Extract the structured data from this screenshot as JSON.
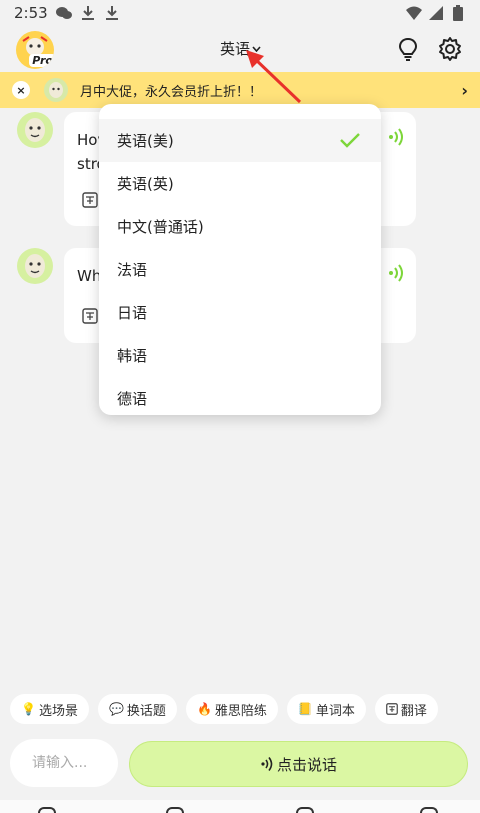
{
  "status_bar": {
    "time": "2:53"
  },
  "header": {
    "pro_badge": "Pro",
    "language": "英语"
  },
  "promo": {
    "close": "×",
    "text": "月中大促，永久会员折上折！！",
    "arrow": "›"
  },
  "messages": [
    {
      "text_visible": "Hov",
      "text_line2": "stro"
    },
    {
      "text_visible": "Wh"
    }
  ],
  "dropdown": {
    "items": [
      {
        "label": "英语(美)",
        "selected": true
      },
      {
        "label": "英语(英)",
        "selected": false
      },
      {
        "label": "中文(普通话)",
        "selected": false
      },
      {
        "label": "法语",
        "selected": false
      },
      {
        "label": "日语",
        "selected": false
      },
      {
        "label": "韩语",
        "selected": false
      },
      {
        "label": "德语",
        "selected": false
      }
    ]
  },
  "chips": [
    {
      "emoji": "💡",
      "label": "选场景"
    },
    {
      "emoji": "💬",
      "label": "换话题"
    },
    {
      "emoji": "🔥",
      "label": "雅思陪练"
    },
    {
      "emoji": "📒",
      "label": "单词本"
    },
    {
      "emoji": "",
      "label": "翻译"
    }
  ],
  "input": {
    "placeholder": "请输入..."
  },
  "talk_button": {
    "label": "点击说话"
  },
  "colors": {
    "promo_bg": "#ffe27a",
    "accent_green": "#7dd63a",
    "talk_bg": "#dbf7a3",
    "annotation_red": "#e8312b"
  }
}
